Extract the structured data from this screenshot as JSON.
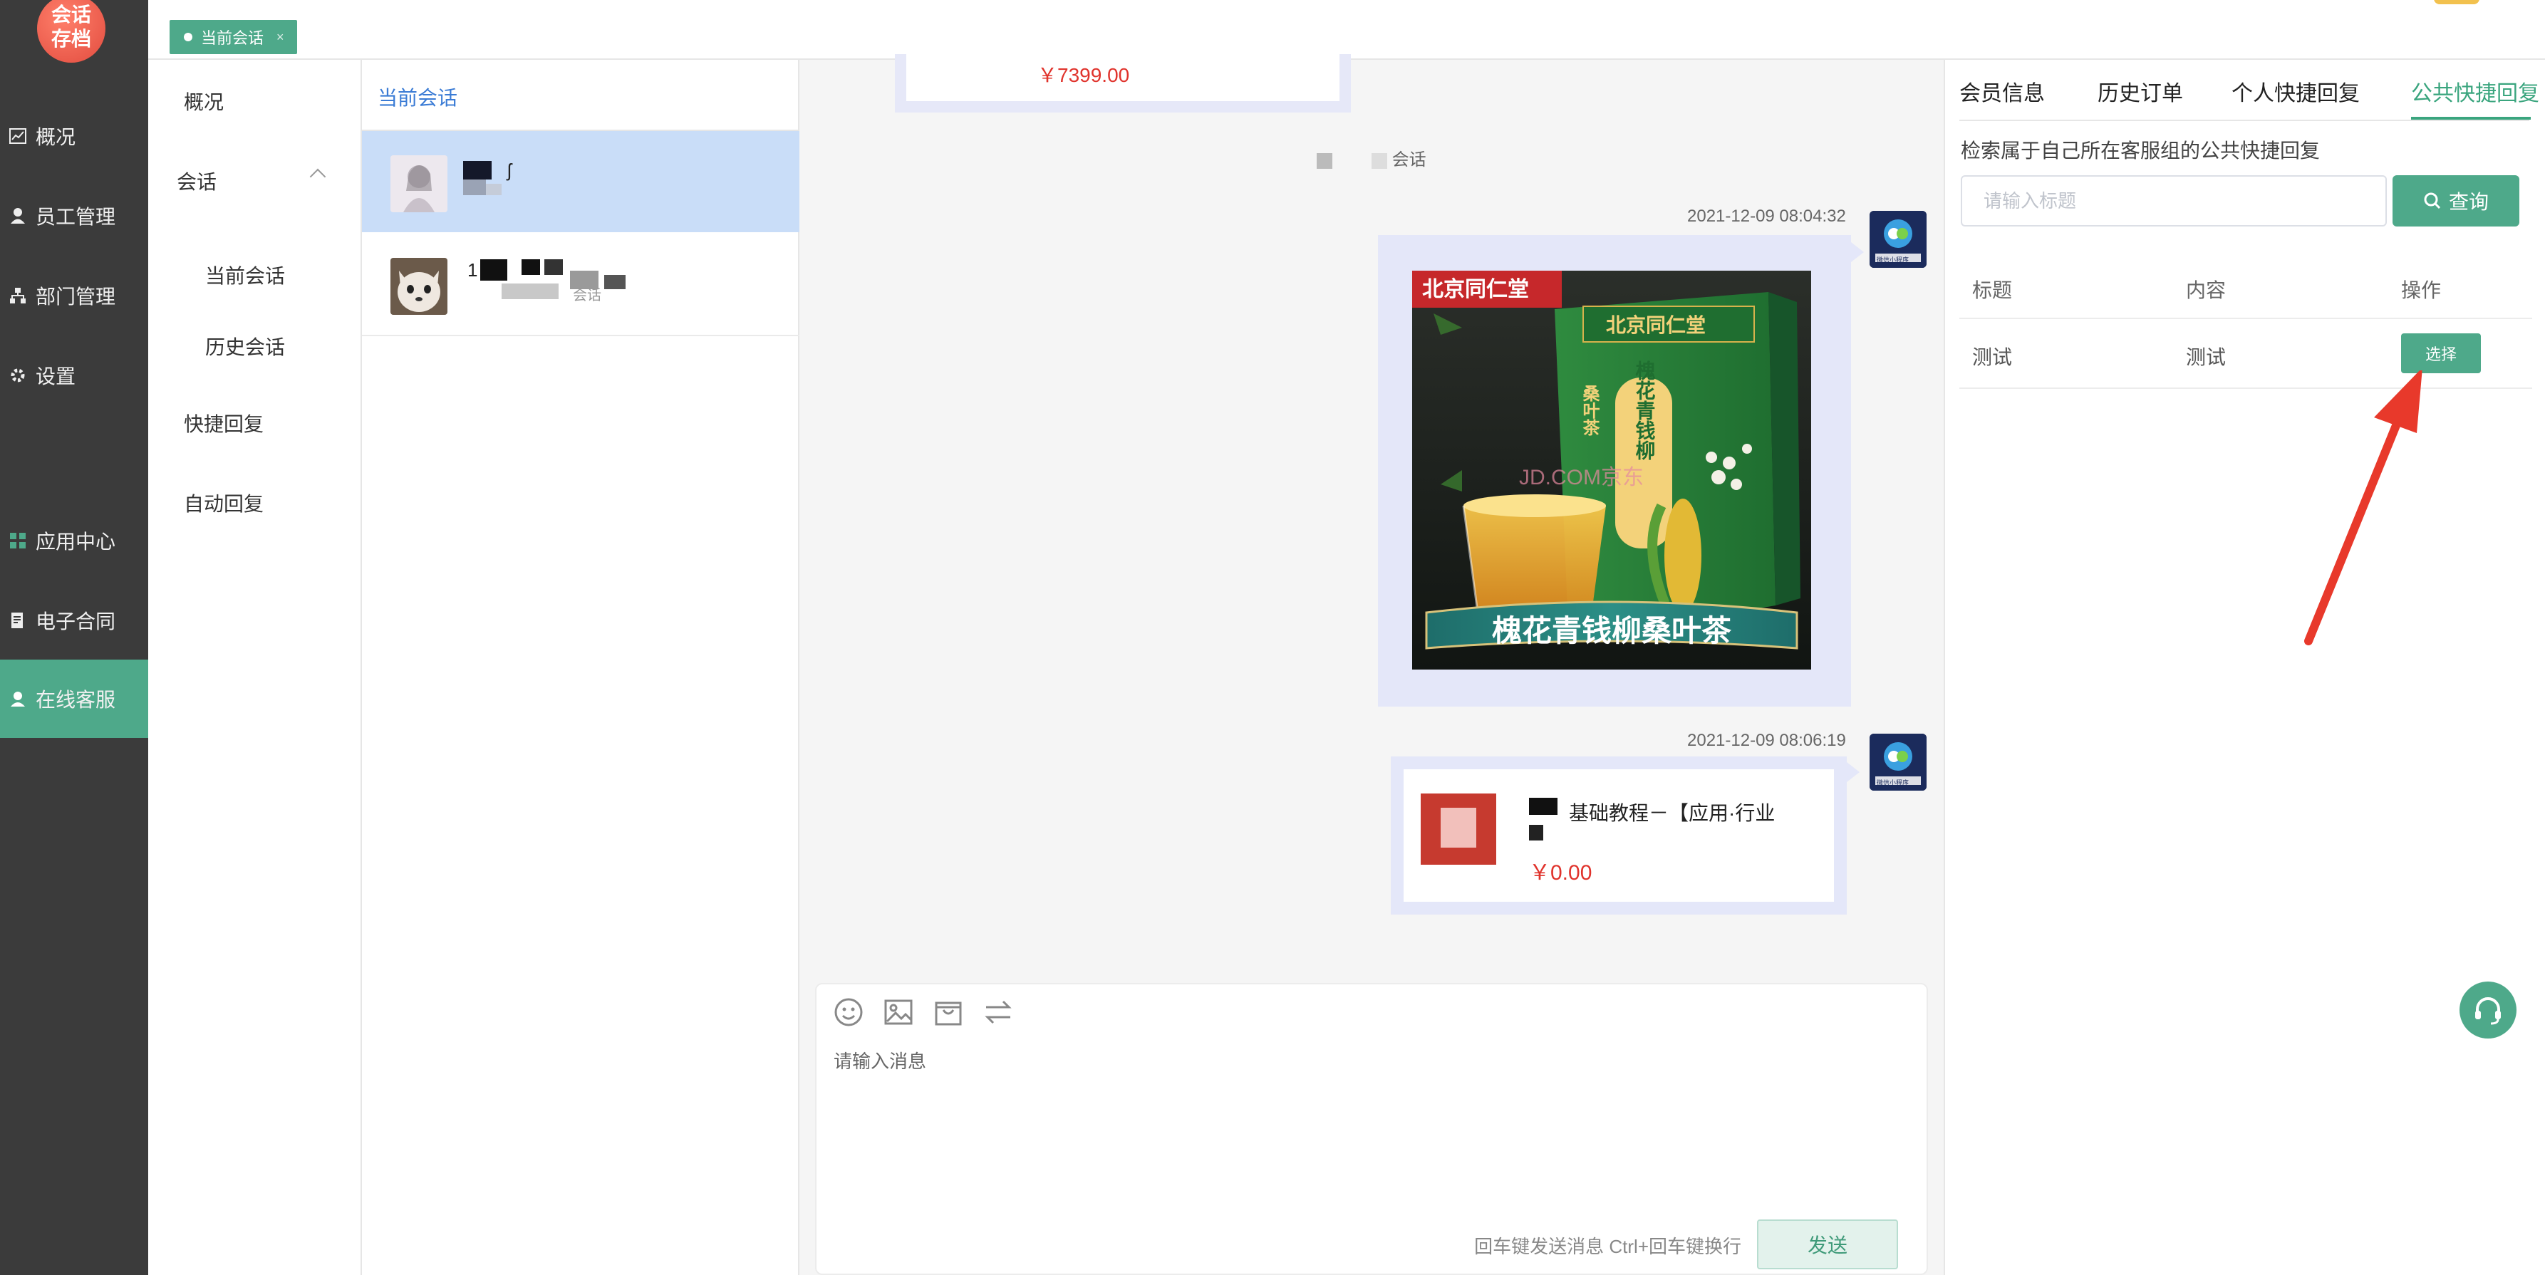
{
  "logo": {
    "line1": "会话",
    "line2": "存档"
  },
  "nav": [
    {
      "label": "概况",
      "icon": "chart-icon"
    },
    {
      "label": "员工管理",
      "icon": "user-icon"
    },
    {
      "label": "部门管理",
      "icon": "org-icon"
    },
    {
      "label": "设置",
      "icon": "gear-icon"
    },
    {
      "label": "应用中心",
      "icon": "apps-icon"
    },
    {
      "label": "电子合同",
      "icon": "contract-icon"
    },
    {
      "label": "在线客服",
      "icon": "support-icon",
      "active": true
    }
  ],
  "top_tab": {
    "label": "当前会话",
    "close": "×"
  },
  "submenu": {
    "overview": "概况",
    "session": "会话",
    "current_session": "当前会话",
    "history_session": "历史会话",
    "quick_reply": "快捷回复",
    "auto_reply": "自动回复"
  },
  "sessions": {
    "title": "当前会话",
    "items": [
      {
        "name": "ʃ",
        "active": true
      },
      {
        "name": "1",
        "sub": "会话",
        "active": false
      }
    ]
  },
  "chat": {
    "top_price": "￥7399.00",
    "system_note": "会话",
    "messages": [
      {
        "time": "2021-12-09 08:04:32",
        "type": "image",
        "brand": "北京同仁堂",
        "product_name": "槐花青钱柳桑叶茶",
        "box_text": "槐花青钱柳",
        "box_side": "桑叶茶",
        "watermark": "JD.COM京东"
      },
      {
        "time": "2021-12-09 08:06:19",
        "type": "product",
        "title": "基础教程－【应用·行业",
        "price": "￥0.00"
      }
    ],
    "avatar_caption": "微信小程序",
    "input_placeholder": "请输入消息",
    "hint": "回车键发送消息 Ctrl+回车键换行",
    "send_label": "发送"
  },
  "right_panel": {
    "tabs": [
      "会员信息",
      "历史订单",
      "个人快捷回复",
      "公共快捷回复"
    ],
    "active_tab": 3,
    "description": "检索属于自己所在客服组的公共快捷回复",
    "search_placeholder": "请输入标题",
    "query_label": "查询",
    "columns": [
      "标题",
      "内容",
      "操作"
    ],
    "rows": [
      {
        "title": "测试",
        "content": "测试",
        "action": "选择"
      }
    ]
  },
  "colors": {
    "accent": "#4ea98a",
    "nav_bg": "#3b3b3b",
    "link_blue": "#3a7bd5",
    "price_red": "#e0332c",
    "arrow_red": "#e8392b"
  }
}
